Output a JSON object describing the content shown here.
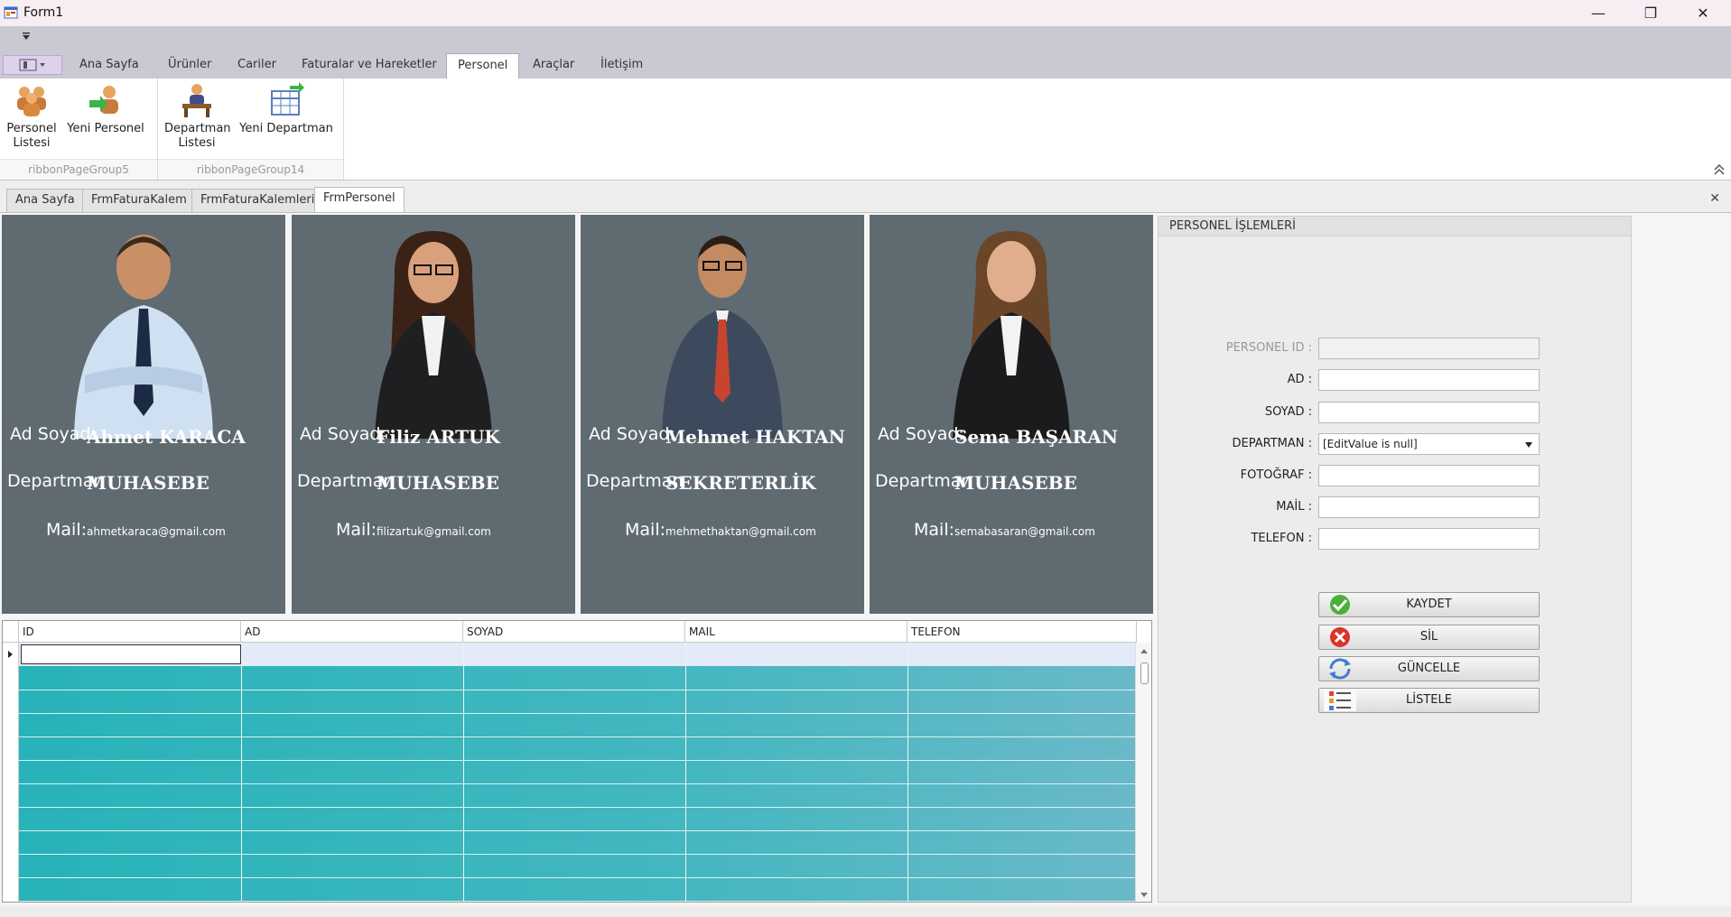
{
  "window": {
    "title": "Form1",
    "minimize": "—",
    "restore": "❐",
    "close": "✕"
  },
  "ribbon": {
    "tabs": [
      {
        "label": "Ana Sayfa"
      },
      {
        "label": "Ürünler"
      },
      {
        "label": "Cariler"
      },
      {
        "label": "Faturalar ve Hareketler"
      },
      {
        "label": "Personel"
      },
      {
        "label": "Araçlar"
      },
      {
        "label": "İletişim"
      }
    ],
    "active_tab": "Personel",
    "groups": [
      {
        "caption": "ribbonPageGroup5",
        "buttons": [
          {
            "label_line1": "Personel",
            "label_line2": "Listesi",
            "icon": "people-group-icon"
          },
          {
            "label_line1": "Yeni Personel",
            "label_line2": "",
            "icon": "add-person-icon"
          }
        ]
      },
      {
        "caption": "ribbonPageGroup14",
        "buttons": [
          {
            "label_line1": "Departman",
            "label_line2": "Listesi",
            "icon": "office-desk-icon"
          },
          {
            "label_line1": "Yeni Departman",
            "label_line2": "",
            "icon": "table-add-icon"
          }
        ]
      }
    ]
  },
  "doc_tabs": [
    {
      "label": "Ana Sayfa"
    },
    {
      "label": "FrmFaturaKalem"
    },
    {
      "label": "FrmFaturaKalemleri"
    },
    {
      "label": "FrmPersonel"
    }
  ],
  "active_doc_tab": "FrmPersonel",
  "card_labels": {
    "name": "Ad Soyad:",
    "department": "Departman",
    "mail": "Mail:"
  },
  "cards": [
    {
      "name": "Ahmet KARACA",
      "department": "MUHASEBE",
      "mail": "ahmetkaraca@gmail.com"
    },
    {
      "name": "Filiz ARTUK",
      "department": "MUHASEBE",
      "mail": "filizartuk@gmail.com"
    },
    {
      "name": "Mehmet  HAKTAN",
      "department": "SEKRETERLİK",
      "mail": "mehmethaktan@gmail.com"
    },
    {
      "name": "Sema BAŞARAN",
      "department": "MUHASEBE",
      "mail": "semabasaran@gmail.com"
    }
  ],
  "grid": {
    "columns": [
      "ID",
      "AD",
      "SOYAD",
      "MAIL",
      "TELEFON"
    ],
    "row_color": "#27b3b8"
  },
  "panel": {
    "title": "PERSONEL İŞLEMLERİ",
    "fields": {
      "id": {
        "label": "PERSONEL ID :",
        "value": ""
      },
      "ad": {
        "label": "AD :",
        "value": ""
      },
      "soyad": {
        "label": "SOYAD :",
        "value": ""
      },
      "departman": {
        "label": "DEPARTMAN :",
        "value": "[EditValue is null]"
      },
      "foto": {
        "label": "FOTOĞRAF :",
        "value": ""
      },
      "mail": {
        "label": "MAİL :",
        "value": ""
      },
      "telefon": {
        "label": "TELEFON :",
        "value": ""
      }
    },
    "buttons": {
      "save": "KAYDET",
      "delete": "SİL",
      "update": "GÜNCELLE",
      "list": "LİSTELE"
    }
  }
}
